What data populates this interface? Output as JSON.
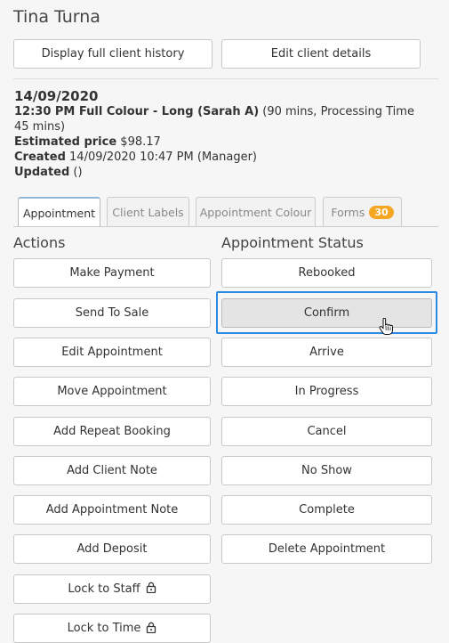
{
  "client": {
    "name": "Tina Turna"
  },
  "top_buttons": {
    "history": "Display full client history",
    "edit": "Edit client details"
  },
  "appointment": {
    "date": "14/09/2020",
    "service_bold": "12:30 PM Full Colour - Long (Sarah A)",
    "service_rest": " (90 mins, Processing Time 45 mins)",
    "price_label": "Estimated price",
    "price_value": " $98.17",
    "created_label": "Created",
    "created_value": " 14/09/2020 10:47 PM (Manager)",
    "updated_label": "Updated",
    "updated_value": " ()"
  },
  "tabs": {
    "appointment": "Appointment",
    "client_labels": "Client Labels",
    "appointment_colour": "Appointment Colour",
    "forms": "Forms",
    "forms_count": "30"
  },
  "actions": {
    "title": "Actions",
    "items": [
      "Make Payment",
      "Send To Sale",
      "Edit Appointment",
      "Move Appointment",
      "Add Repeat Booking",
      "Add Client Note",
      "Add Appointment Note",
      "Add Deposit",
      "Lock to Staff",
      "Lock to Time"
    ]
  },
  "status": {
    "title": "Appointment Status",
    "items": [
      "Rebooked",
      "Confirm",
      "Arrive",
      "In Progress",
      "Cancel",
      "No Show",
      "Complete",
      "Delete Appointment"
    ],
    "selected": "Confirm"
  },
  "icons": {
    "lock": "lock-icon",
    "cursor": "hand-pointer-icon"
  },
  "colors": {
    "badge": "#f5a623",
    "highlight": "#2a8be0"
  }
}
